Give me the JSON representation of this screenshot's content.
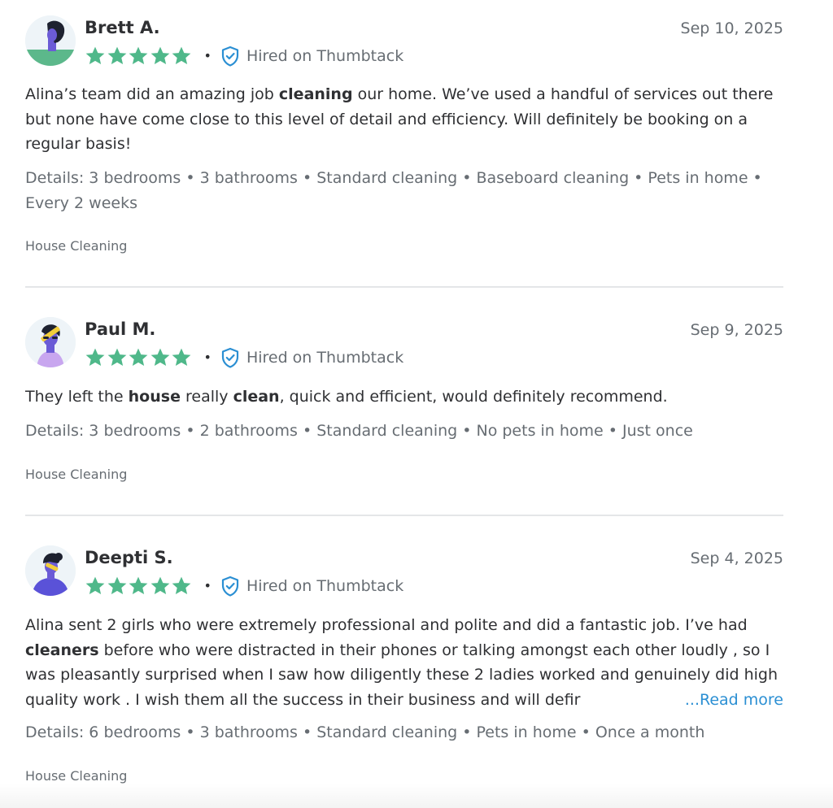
{
  "colors": {
    "star": "#4fb88a",
    "text_primary": "#2f3033",
    "text_secondary": "#676d73",
    "link": "#2b8fd3",
    "shield": "#2b8fd3",
    "divider": "#e4e6e8"
  },
  "reviews": [
    {
      "name": "Brett A.",
      "date": "Sep 10, 2025",
      "rating": 5,
      "stars_icon": "star-icon",
      "badge_icon": "shield-check-icon",
      "badge": "Hired on Thumbtack",
      "body_segments": [
        {
          "text": "Alina’s team did an amazing job ",
          "bold": false
        },
        {
          "text": "cleaning",
          "bold": true
        },
        {
          "text": " our home. We’ve used a handful of services out there but none have come close to this level of detail and efficiency. Will definitely be booking on a regular basis!",
          "bold": false
        }
      ],
      "details": "Details: 3 bedrooms • 3 bathrooms • Standard cleaning • Baseboard cleaning • Pets in home • Every 2 weeks",
      "category": "House Cleaning"
    },
    {
      "name": "Paul M.",
      "date": "Sep 9, 2025",
      "rating": 5,
      "stars_icon": "star-icon",
      "badge_icon": "shield-check-icon",
      "badge": "Hired on Thumbtack",
      "body_segments": [
        {
          "text": "They left the ",
          "bold": false
        },
        {
          "text": "house",
          "bold": true
        },
        {
          "text": " really ",
          "bold": false
        },
        {
          "text": "clean",
          "bold": true
        },
        {
          "text": ", quick and efficient, would definitely recommend.",
          "bold": false
        }
      ],
      "details": "Details: 3 bedrooms • 2 bathrooms • Standard cleaning • No pets in home • Just once",
      "category": "House Cleaning"
    },
    {
      "name": "Deepti S.",
      "date": "Sep 4, 2025",
      "rating": 5,
      "stars_icon": "star-icon",
      "badge_icon": "shield-check-icon",
      "badge": "Hired on Thumbtack",
      "body_segments": [
        {
          "text": "Alina sent 2 girls who were extremely professional and polite and did a fantastic job. I’ve had ",
          "bold": false
        },
        {
          "text": "cleaners",
          "bold": true
        },
        {
          "text": " before who were distracted in their phones or talking amongst each other loudly , so I was pleasantly surprised when I saw how diligently these 2 ladies worked and genuinely did high quality work . I wish them all the success in their business and will defir",
          "bold": false
        }
      ],
      "read_more": "...Read more",
      "details": "Details: 6 bedrooms • 3 bathrooms • Standard cleaning • Pets in home • Once a month",
      "category": "House Cleaning"
    }
  ]
}
